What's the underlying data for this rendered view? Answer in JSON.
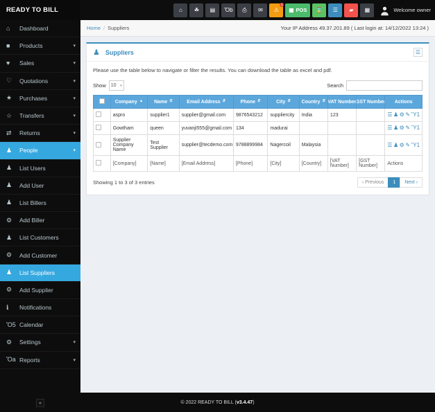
{
  "brand": {
    "title": "READY TO BILL"
  },
  "sidebar": {
    "items": [
      {
        "label": "Dashboard",
        "icon": "home-icon",
        "glyph": "⌂",
        "caret": false,
        "active": false
      },
      {
        "label": "Products",
        "icon": "box-icon",
        "glyph": "■",
        "caret": true,
        "active": false
      },
      {
        "label": "Sales",
        "icon": "heart-icon",
        "glyph": "♥",
        "caret": true,
        "active": false
      },
      {
        "label": "Quotations",
        "icon": "heart-outline-icon",
        "glyph": "♡",
        "caret": true,
        "active": false
      },
      {
        "label": "Purchases",
        "icon": "star-icon",
        "glyph": "★",
        "caret": true,
        "active": false
      },
      {
        "label": "Transfers",
        "icon": "star-outline-icon",
        "glyph": "☆",
        "caret": true,
        "active": false
      },
      {
        "label": "Returns",
        "icon": "shuffle-icon",
        "glyph": "⇄",
        "caret": true,
        "active": false
      },
      {
        "label": "People",
        "icon": "users-icon",
        "glyph": "♟",
        "caret": true,
        "active": true
      },
      {
        "label": "List Users",
        "icon": "users-icon",
        "glyph": "♟",
        "caret": false,
        "active": false
      },
      {
        "label": "Add User",
        "icon": "user-add-icon",
        "glyph": "♟",
        "caret": false,
        "active": false
      },
      {
        "label": "List Billers",
        "icon": "users-icon",
        "glyph": "♟",
        "caret": false,
        "active": false
      },
      {
        "label": "Add Biller",
        "icon": "plus-circle-icon",
        "glyph": "⚙",
        "caret": false,
        "active": false
      },
      {
        "label": "List Customers",
        "icon": "users-icon",
        "glyph": "♟",
        "caret": false,
        "active": false
      },
      {
        "label": "Add Customer",
        "icon": "plus-circle-icon",
        "glyph": "⚙",
        "caret": false,
        "active": false
      },
      {
        "label": "List Suppliers",
        "icon": "users-icon",
        "glyph": "♟",
        "caret": false,
        "active": true
      },
      {
        "label": "Add Supplier",
        "icon": "plus-circle-icon",
        "glyph": "⚙",
        "caret": false,
        "active": false
      },
      {
        "label": "Notifications",
        "icon": "info-icon",
        "glyph": "ℹ",
        "caret": false,
        "active": false
      },
      {
        "label": "Calendar",
        "icon": "calendar-icon",
        "glyph": "Ὄ5",
        "caret": false,
        "active": false
      },
      {
        "label": "Settings",
        "icon": "gear-icon",
        "glyph": "⚙",
        "caret": true,
        "active": false
      },
      {
        "label": "Reports",
        "icon": "chart-bar-icon",
        "glyph": "Ὄa",
        "caret": true,
        "active": false
      }
    ],
    "collapse_glyph": "«"
  },
  "topbar": {
    "buttons": [
      {
        "name": "home-icon",
        "glyph": "⌂",
        "color": "#3b3f45",
        "label": "",
        "badge": ""
      },
      {
        "name": "share-icon",
        "glyph": "☘",
        "color": "#3b3f45",
        "label": "",
        "badge": ""
      },
      {
        "name": "save-icon",
        "glyph": "▤",
        "color": "#3b3f45",
        "label": "",
        "badge": ""
      },
      {
        "name": "clipboard-icon",
        "glyph": "Ὄb",
        "color": "#3b3f45",
        "label": "",
        "badge": ""
      },
      {
        "name": "printer-icon",
        "glyph": "⎙",
        "color": "#3b3f45",
        "label": "",
        "badge": ""
      },
      {
        "name": "bell-icon",
        "glyph": "✉",
        "color": "#3b3f45",
        "label": "",
        "badge": ""
      },
      {
        "name": "warning-icon",
        "glyph": "⚠",
        "color": "#f39c12",
        "label": "",
        "badge": "1"
      },
      {
        "name": "pos-button",
        "glyph": "▦",
        "color": "#4cbb6c",
        "label": "POS",
        "badge": ""
      },
      {
        "name": "hourglass-icon",
        "glyph": "⌛",
        "color": "#5bc364",
        "label": "",
        "badge": ""
      },
      {
        "name": "list-icon",
        "glyph": "☰",
        "color": "#3c8dbc",
        "label": "",
        "badge": ""
      },
      {
        "name": "eraser-icon",
        "glyph": "▰",
        "color": "#f4524d",
        "label": "",
        "badge": ""
      },
      {
        "name": "grid-icon",
        "glyph": "▦",
        "color": "#3b3f45",
        "label": "",
        "badge": ""
      }
    ],
    "welcome": "Welcome owner"
  },
  "breadcrumb": {
    "home": "Home",
    "separator": "/",
    "current": "Suppliers"
  },
  "ipinfo": "Your IP Address 49.37.201.89 ( Last login at: 14/12/2022 13:24 )",
  "panel": {
    "icon": "users-icon",
    "title": "Suppliers",
    "tool_icon": "list-toggle-icon",
    "description": "Please use the table below to navigate or filter the results. You can download the table as excel and pdf."
  },
  "table_controls": {
    "show_label": "Show",
    "show_value": "10",
    "search_label": "Search",
    "search_value": "",
    "search_placeholder": ""
  },
  "table": {
    "columns": [
      {
        "label": "Company",
        "sort": "asc"
      },
      {
        "label": "Name",
        "sort": "both"
      },
      {
        "label": "Email Address",
        "sort": "both"
      },
      {
        "label": "Phone",
        "sort": "both"
      },
      {
        "label": "City",
        "sort": "both"
      },
      {
        "label": "Country",
        "sort": "both"
      },
      {
        "label": "VAT Number",
        "sort": "none"
      },
      {
        "label": "GST Number",
        "sort": "none"
      },
      {
        "label": "Actions",
        "sort": "none"
      }
    ],
    "rows": [
      {
        "company": "aspro",
        "name": "supplier1",
        "email": "supplier@gmail.com",
        "phone": "9876543212",
        "city": "suppliercity",
        "country": "India",
        "vat": "123",
        "gst": ""
      },
      {
        "company": "Gowtham",
        "name": "queen",
        "email": "yuvanji555@gmail.com",
        "phone": "134",
        "city": "madurai",
        "country": "",
        "vat": "",
        "gst": ""
      },
      {
        "company": "Supplier Company Name",
        "name": "Test Supplier",
        "email": "supplier@tecdemo.com",
        "phone": "9788899984",
        "city": "Nagercoil",
        "country": "Malaysia",
        "vat": "",
        "gst": ""
      }
    ],
    "action_icons": [
      {
        "name": "list-icon",
        "glyph": "☰"
      },
      {
        "name": "users-icon",
        "glyph": "♟"
      },
      {
        "name": "gear-icon",
        "glyph": "⚙"
      },
      {
        "name": "edit-icon",
        "glyph": "✎"
      },
      {
        "name": "delete-icon",
        "glyph": "Ὕ1"
      }
    ],
    "footer_filters": [
      "[Company]",
      "[Name]",
      "[Email Address]",
      "[Phone]",
      "[City]",
      "[Country]",
      "[VAT Number]",
      "[GST Number]"
    ],
    "footer_actions_label": "Actions"
  },
  "pagination": {
    "info": "Showing 1 to 3 of 3 entries",
    "previous": "‹ Previous",
    "page": "1",
    "next": "Next ›"
  },
  "footer": {
    "text": "© 2022 READY TO BILL (",
    "version": "v3.4.47",
    "tail": " )"
  }
}
